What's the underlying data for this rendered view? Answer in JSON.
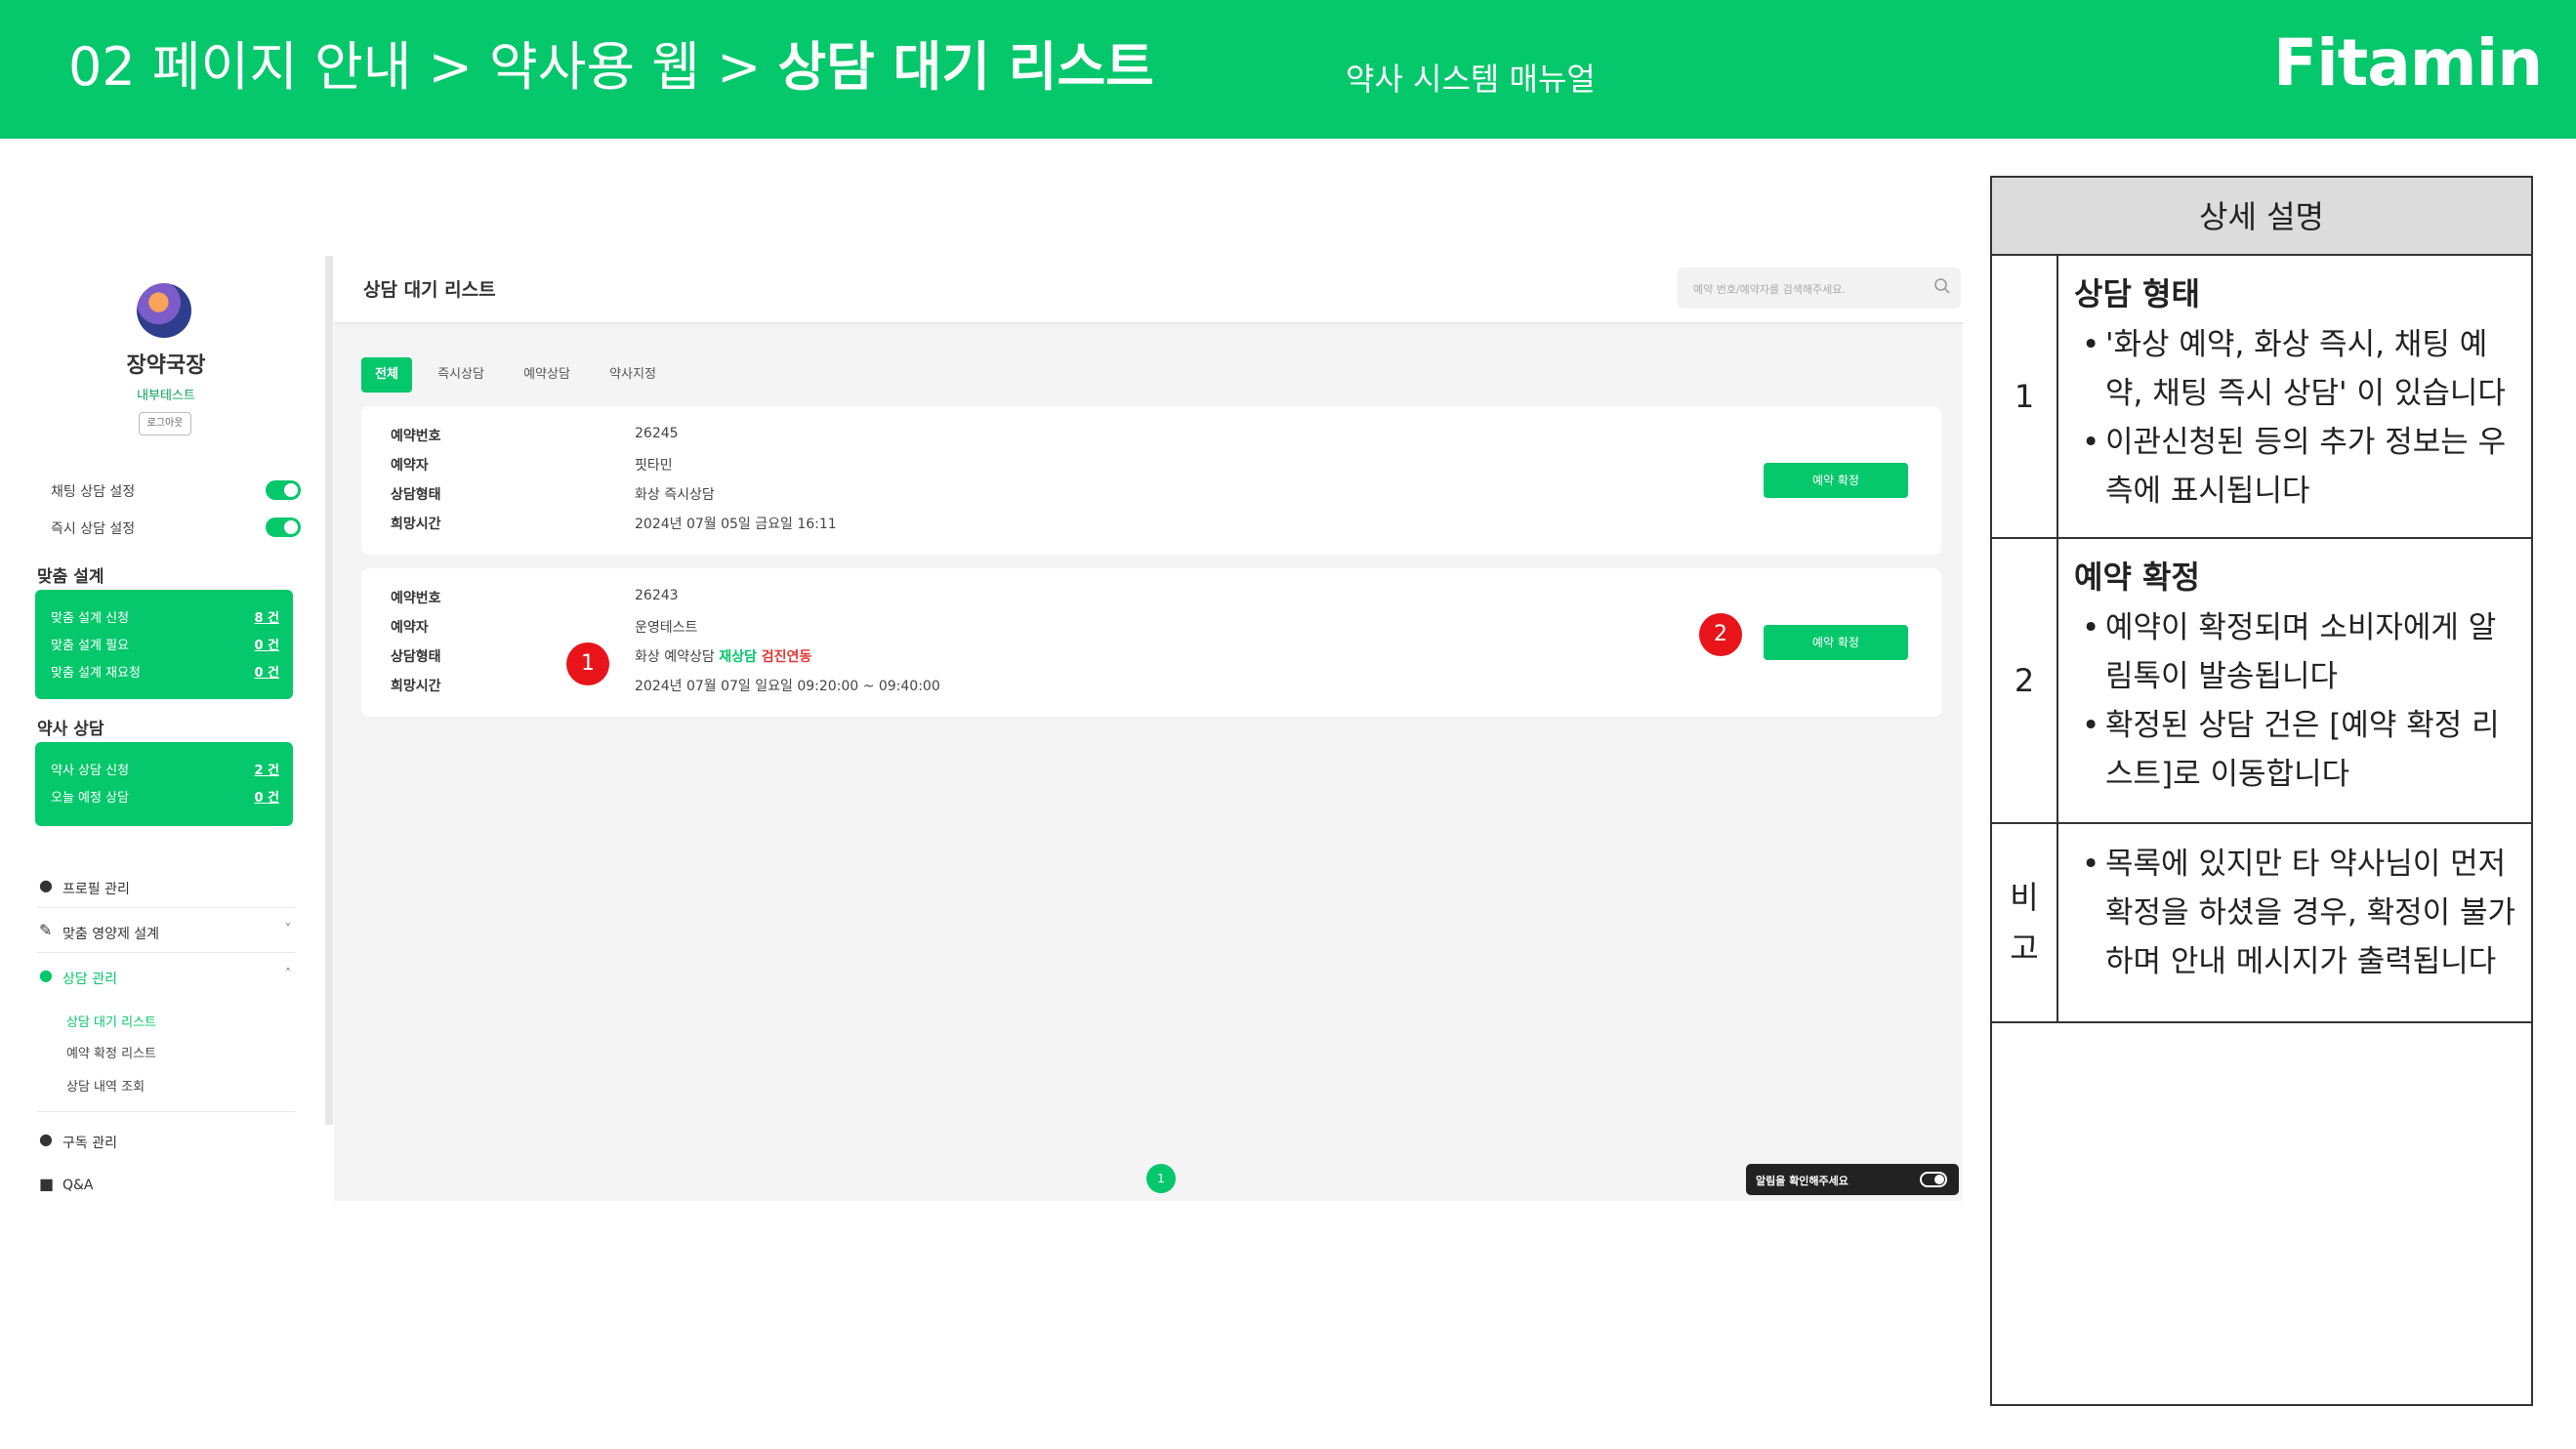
{
  "header": {
    "breadcrumb_prefix": "02 페이지 안내 > 약사용 웹 > ",
    "breadcrumb_current": "상담 대기 리스트",
    "manual_label": "약사 시스템 매뉴얼",
    "brand": "Fitamin",
    "colors": {
      "brand_green": "#05c76b",
      "marker_red": "#e8141a"
    }
  },
  "sidebar": {
    "profile_name": "장약국장",
    "profile_sub": "내부테스트",
    "logout_label": "로그아웃",
    "toggles": [
      {
        "label": "채팅 상담 설정",
        "on": true
      },
      {
        "label": "즉시 상담 설정",
        "on": true
      }
    ],
    "custom_design": {
      "title": "맞춤 설계",
      "rows": [
        {
          "label": "맞춤 설계 신청",
          "value": "8 건"
        },
        {
          "label": "맞춤 설계 필요",
          "value": "0 건"
        },
        {
          "label": "맞춤 설계 재요청",
          "value": "0 건"
        }
      ]
    },
    "pharmacist_consult": {
      "title": "약사 상담",
      "rows": [
        {
          "label": "약사 상담 신청",
          "value": "2 건"
        },
        {
          "label": "오늘 예정 상담",
          "value": "0 건"
        }
      ]
    },
    "nav": [
      {
        "label": "프로필 관리",
        "icon": "person-settings-icon"
      },
      {
        "label": "맞춤 영양제 설계",
        "icon": "pen-icon",
        "chevron": "˅"
      },
      {
        "label": "상담 관리",
        "icon": "person-settings-icon",
        "chevron": "˄"
      },
      {
        "label": "구독 관리",
        "icon": "person-settings-icon"
      },
      {
        "label": "Q&A",
        "icon": "chat-icon"
      }
    ],
    "consult_sub": [
      "상담 대기 리스트",
      "예약 확정 리스트",
      "상담 내역 조회"
    ]
  },
  "main": {
    "title": "상담 대기 리스트",
    "search_placeholder": "예약 번호/예약자를 검색해주세요.",
    "tabs": [
      "전체",
      "즉시상담",
      "예약상담",
      "약사지정"
    ],
    "field_labels": [
      "예약번호",
      "예약자",
      "상담형태",
      "희망시간"
    ],
    "cards": [
      {
        "reservation_no": "26245",
        "reserver": "핏타민",
        "type": "화상 즉시상담",
        "type_tag_green": "",
        "type_tag_red": "",
        "time": "2024년 07월 05일 금요일 16:11",
        "button": "예약 확정"
      },
      {
        "reservation_no": "26243",
        "reserver": "운영테스트",
        "type": "화상 예약상담 ",
        "type_tag_green": "재상담",
        "type_tag_red": " 검진연동",
        "time": "2024년 07월 07일 일요일 09:20:00 ~ 09:40:00",
        "button": "예약 확정"
      }
    ],
    "markers": [
      "1",
      "2"
    ],
    "page_number": "1",
    "alarm_label": "알림을 확인해주세요"
  },
  "description": {
    "header": "상세 설명",
    "rows": [
      {
        "num": "1",
        "heading": "상담 형태",
        "bullets": [
          "'화상 예약, 화상 즉시, 채팅 예약, 채팅 즉시 상담' 이 있습니다",
          "이관신청된 등의 추가 정보는 우측에 표시됩니다"
        ]
      },
      {
        "num": "2",
        "heading": "예약 확정",
        "bullets": [
          "예약이 확정되며 소비자에게 알림톡이 발송됩니다",
          "확정된 상담 건은 [예약 확정 리스트]로 이동합니다"
        ]
      },
      {
        "num_line1": "비",
        "num_line2": "고",
        "bullets": [
          "목록에 있지만 타 약사님이 먼저 확정을 하셨을 경우, 확정이 불가하며 안내 메시지가 출력됩니다"
        ]
      }
    ]
  }
}
